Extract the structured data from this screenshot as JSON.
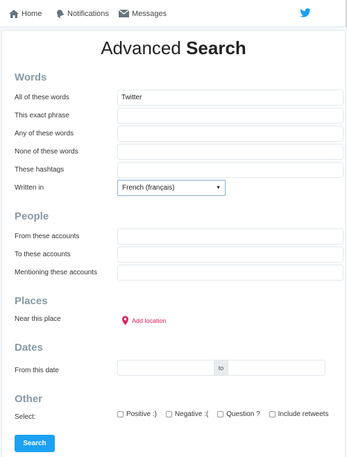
{
  "nav": {
    "home_label": "Home",
    "notifications_label": "Notifications",
    "messages_label": "Messages",
    "brand_color": "#1da1f2"
  },
  "page": {
    "title_light": "Advanced",
    "title_bold": "Search"
  },
  "words": {
    "heading": "Words",
    "all_label": "All of these words",
    "all_value": "Twitter",
    "exact_label": "This exact phrase",
    "exact_value": "",
    "any_label": "Any of these words",
    "any_value": "",
    "none_label": "None of these words",
    "none_value": "",
    "hashtags_label": "These hashtags",
    "hashtags_value": "",
    "language_label": "Written in",
    "language_value": "French (français)"
  },
  "people": {
    "heading": "People",
    "from_label": "From these accounts",
    "to_label": "To these accounts",
    "mentioning_label": "Mentioning these accounts"
  },
  "places": {
    "heading": "Places",
    "near_label": "Near this place",
    "add_location_label": "Add location",
    "location_color": "#e0245e"
  },
  "dates": {
    "heading": "Dates",
    "from_label": "From this date",
    "to_label": "to"
  },
  "other": {
    "heading": "Other",
    "select_label": "Select:",
    "options": {
      "positive": "Positive :)",
      "negative": "Negative :(",
      "question": "Question ?",
      "retweets": "Include retweets"
    }
  },
  "search_button_label": "Search",
  "icons": {
    "home": "home-icon",
    "notifications": "bell-icon",
    "messages": "envelope-icon",
    "brand": "bird-icon",
    "location": "map-pin-icon",
    "dropdown": "chevron-down-icon"
  }
}
